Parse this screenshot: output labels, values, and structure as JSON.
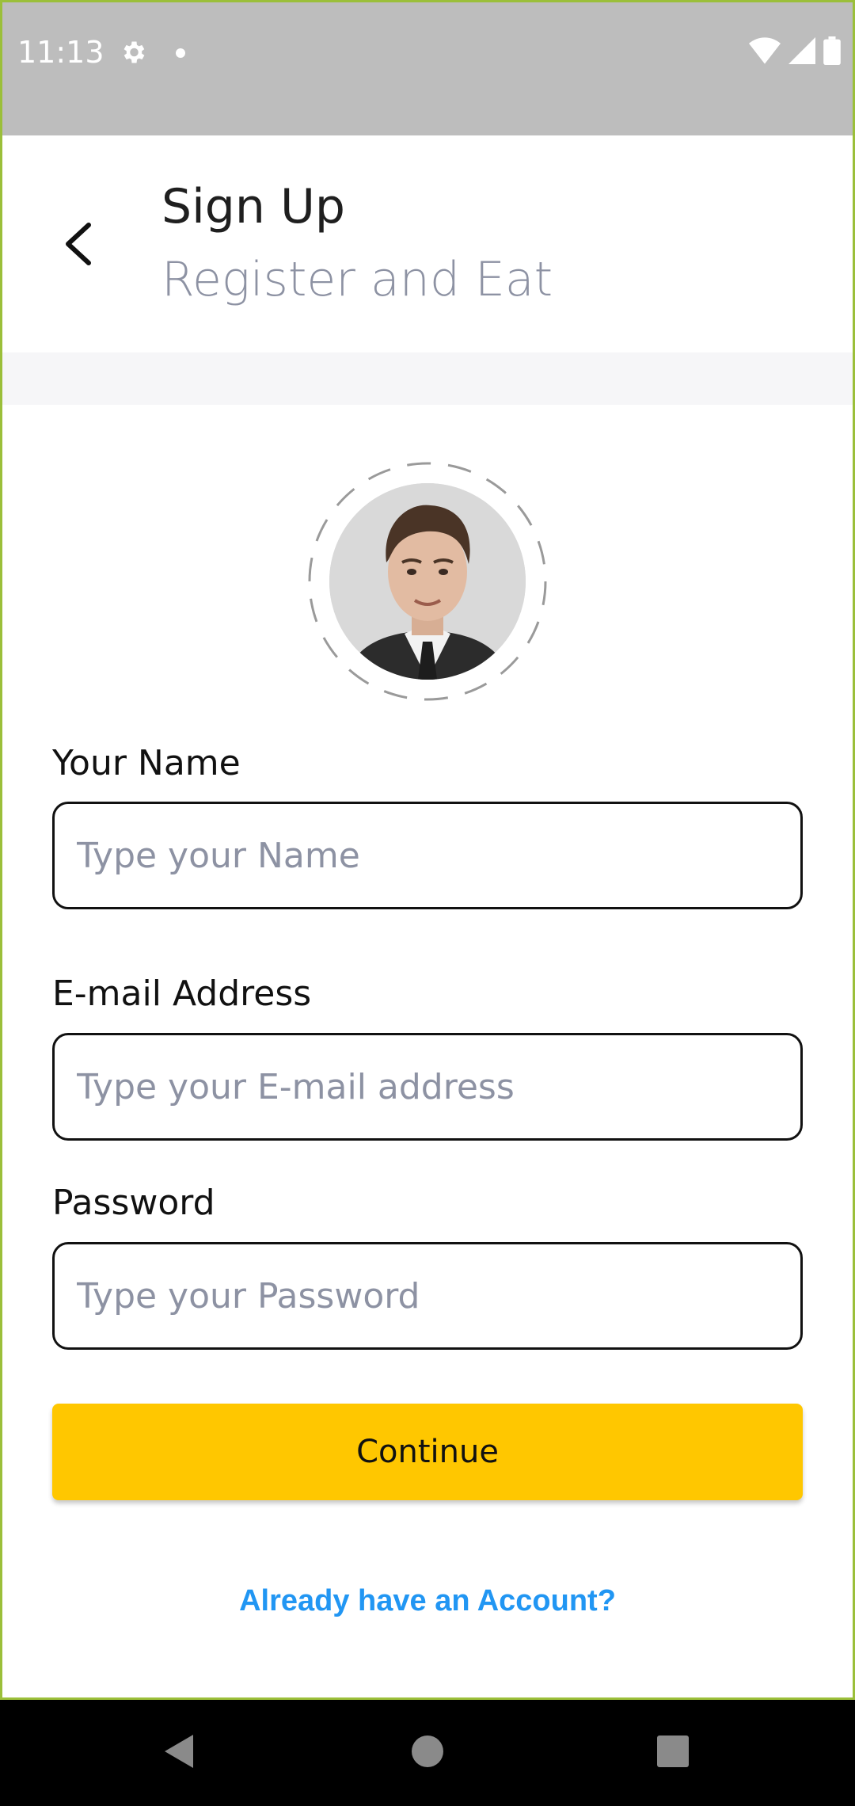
{
  "status_bar": {
    "time": "11:13",
    "icons": [
      "gear-icon",
      "notification-dot-icon",
      "wifi-icon",
      "cellular-signal-icon",
      "battery-icon"
    ]
  },
  "header": {
    "title": "Sign Up",
    "subtitle": "Register and Eat",
    "back_icon": "chevron-left-icon"
  },
  "avatar": {
    "icon": "profile-photo"
  },
  "form": {
    "name": {
      "label": "Your Name",
      "placeholder": "Type your Name",
      "value": ""
    },
    "email": {
      "label": "E-mail Address",
      "placeholder": "Type your E-mail address",
      "value": ""
    },
    "password": {
      "label": "Password",
      "placeholder": "Type your Password",
      "value": ""
    }
  },
  "actions": {
    "continue_label": "Continue",
    "login_link": "Already have an Account?"
  },
  "nav_bar": {
    "icons": [
      "back-triangle-icon",
      "home-circle-icon",
      "recents-square-icon"
    ]
  },
  "colors": {
    "accent": "#ffc700",
    "link": "#2196f3",
    "status_bar": "#bdbdbd",
    "placeholder": "#8d92a3"
  }
}
